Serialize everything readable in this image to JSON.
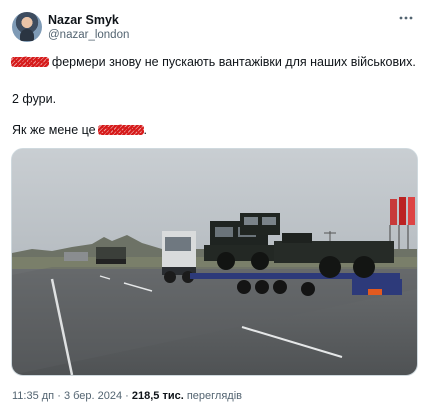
{
  "author": {
    "display_name": "Nazar Smyk",
    "handle": "@nazar_london",
    "avatar_icon": "user-avatar",
    "more_icon": "more-dots-icon"
  },
  "post": {
    "line1_redacted": "Хбали",
    "line1_rest": " фермери знову не пускають вантажівки для наших військових.",
    "line2": "2 фури.",
    "line3_start": "Як же мене це ",
    "line3_redacted": "заїбало",
    "line3_end": "."
  },
  "media": {
    "description_icon": "photo-trucks"
  },
  "meta": {
    "time": "11:35 дп",
    "separator": " · ",
    "date": "3 бер. 2024",
    "views_count": "218,5 тис.",
    "views_label": " переглядів"
  }
}
